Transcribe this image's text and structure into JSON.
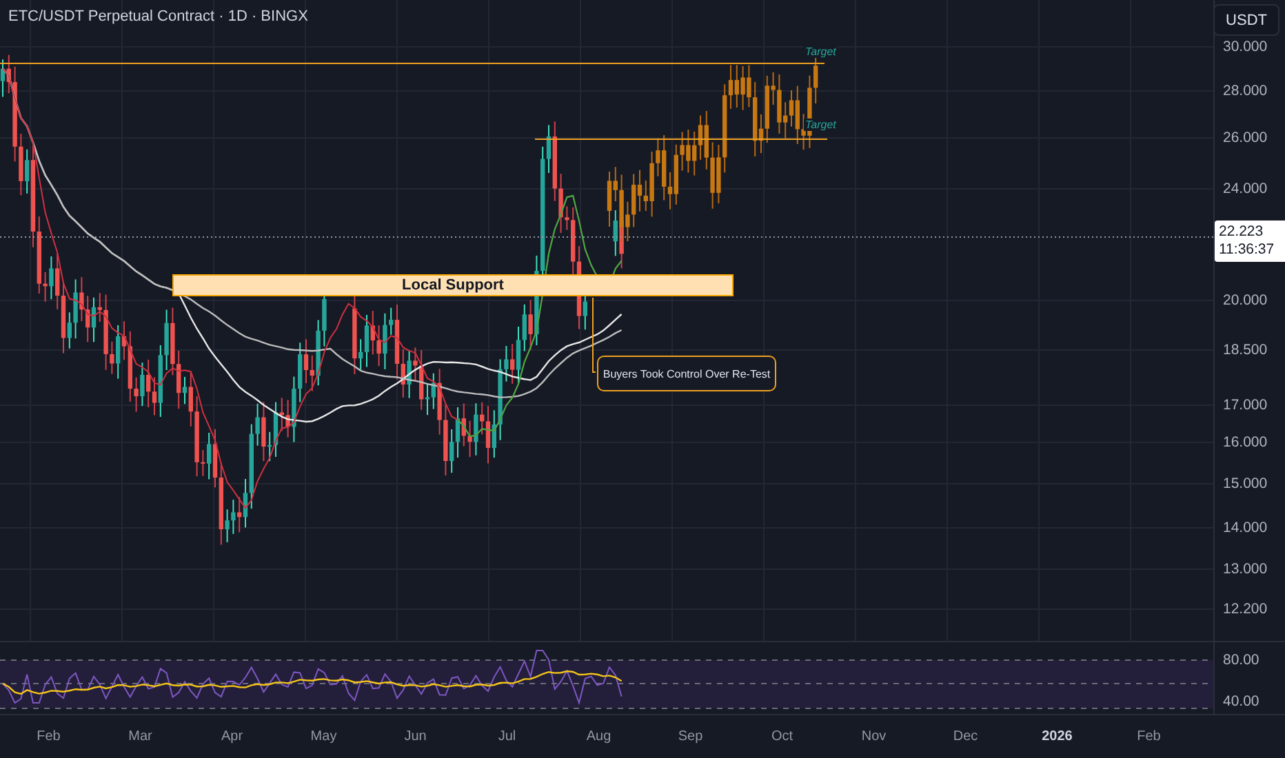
{
  "header": {
    "title": "ETC/USDT Perpetual Contract · 1D · BINGX"
  },
  "currency_button": "USDT",
  "price_axis": [
    "30.000",
    "28.000",
    "26.000",
    "24.000",
    "20.000",
    "18.500",
    "17.000",
    "16.000",
    "15.000",
    "14.000",
    "13.000",
    "12.200"
  ],
  "last_price": {
    "price": "22.223",
    "countdown": "11:36:37"
  },
  "annotations": {
    "targets": [
      "Target",
      "Target"
    ],
    "support": "Local Support",
    "callout": "Buyers Took Control Over Re-Test"
  },
  "rsi_axis": [
    "80.00",
    "40.00"
  ],
  "time_axis": [
    {
      "label": "Feb",
      "year": false
    },
    {
      "label": "Mar",
      "year": false
    },
    {
      "label": "Apr",
      "year": false
    },
    {
      "label": "May",
      "year": false
    },
    {
      "label": "Jun",
      "year": false
    },
    {
      "label": "Jul",
      "year": false
    },
    {
      "label": "Aug",
      "year": false
    },
    {
      "label": "Sep",
      "year": false
    },
    {
      "label": "Oct",
      "year": false
    },
    {
      "label": "Nov",
      "year": false
    },
    {
      "label": "Dec",
      "year": false
    },
    {
      "label": "2026",
      "year": true
    },
    {
      "label": "Feb",
      "year": false
    }
  ]
}
